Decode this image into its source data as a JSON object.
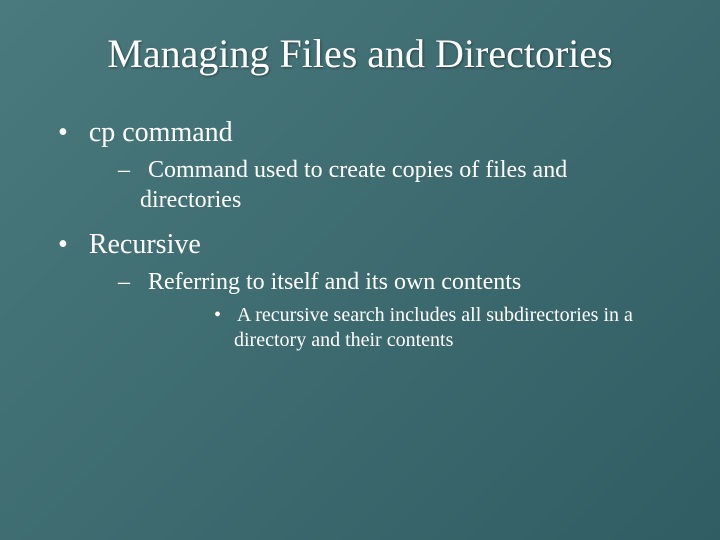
{
  "title": "Managing Files and Directories",
  "bullets": {
    "b1": "cp command",
    "b1_1": "Command used to create copies of files and directories",
    "b2": "Recursive",
    "b2_1": "Referring to itself and its own contents",
    "b2_1_1": "A recursive search includes all subdirectories in a directory and their contents"
  }
}
